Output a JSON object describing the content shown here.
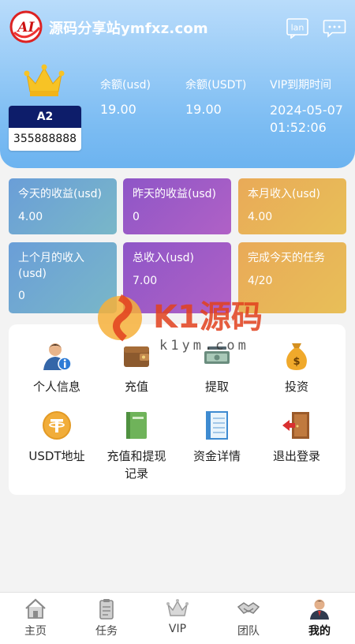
{
  "header": {
    "site_title": "源码分享站ymfxz.com",
    "logo_text": "AI",
    "lang_label": "lan"
  },
  "member": {
    "level": "A2",
    "id": "355888888"
  },
  "stats": [
    {
      "label": "余额(usd)",
      "value": "19.00"
    },
    {
      "label": "余额(USDT)",
      "value": "19.00"
    },
    {
      "label": "VIP到期时间",
      "value": "2024-05-07 01:52:06"
    }
  ],
  "tiles": [
    {
      "label": "今天的收益(usd)",
      "value": "4.00"
    },
    {
      "label": "昨天的收益(usd)",
      "value": "0"
    },
    {
      "label": "本月收入(usd)",
      "value": "4.00"
    },
    {
      "label": "上个月的收入(usd)",
      "value": "0"
    },
    {
      "label": "总收入(usd)",
      "value": "7.00"
    },
    {
      "label": "完成今天的任务",
      "value": "4/20"
    }
  ],
  "menu": [
    {
      "label": "个人信息",
      "icon": "user-info-icon"
    },
    {
      "label": "充值",
      "icon": "wallet-icon"
    },
    {
      "label": "提取",
      "icon": "cash-icon"
    },
    {
      "label": "投资",
      "icon": "money-bag-icon"
    },
    {
      "label": "USDT地址",
      "icon": "tether-coin-icon"
    },
    {
      "label": "充值和提现记录",
      "icon": "record-book-icon"
    },
    {
      "label": "资金详情",
      "icon": "ledger-icon"
    },
    {
      "label": "退出登录",
      "icon": "logout-door-icon"
    }
  ],
  "watermark": {
    "main": "K1源码",
    "sub": "k1ym.com"
  },
  "tabs": [
    {
      "label": "主页",
      "icon": "home-icon"
    },
    {
      "label": "任务",
      "icon": "clipboard-icon"
    },
    {
      "label": "VIP",
      "icon": "crown-icon"
    },
    {
      "label": "团队",
      "icon": "handshake-icon"
    },
    {
      "label": "我的",
      "icon": "person-icon",
      "active": true
    }
  ],
  "colors": {
    "header_gradient_top": "#b9dcfb",
    "header_gradient_bottom": "#6cb3f0",
    "tile_blue": "#6a9ed8",
    "tile_purple": "#9a59c7",
    "tile_orange": "#e9b158",
    "level_badge": "#0d1d6a"
  }
}
